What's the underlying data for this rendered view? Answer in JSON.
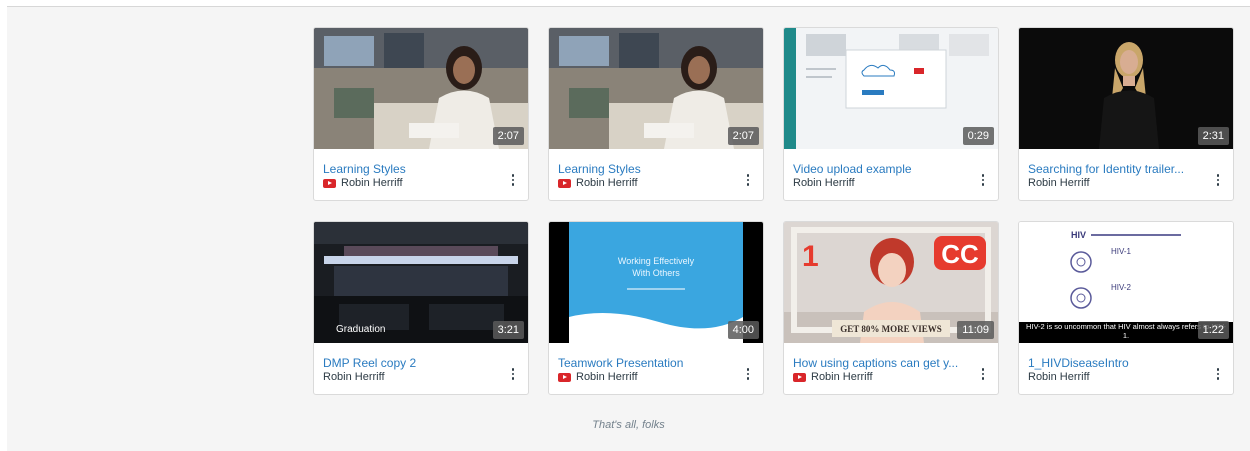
{
  "videos": [
    {
      "title": "Learning Styles",
      "author": "Robin Herriff",
      "duration": "2:07",
      "youtube": true,
      "thumb_icon": "classroom-thumbnail"
    },
    {
      "title": "Learning Styles",
      "author": "Robin Herriff",
      "duration": "2:07",
      "youtube": true,
      "thumb_icon": "classroom-thumbnail"
    },
    {
      "title": "Video upload example",
      "author": "Robin Herriff",
      "duration": "0:29",
      "youtube": false,
      "thumb_icon": "upload-screen-thumbnail"
    },
    {
      "title": "Searching for Identity trailer...",
      "author": "Robin Herriff",
      "duration": "2:31",
      "youtube": false,
      "thumb_icon": "portrait-thumbnail"
    },
    {
      "title": "DMP Reel copy 2",
      "author": "Robin Herriff",
      "duration": "3:21",
      "youtube": false,
      "thumb_icon": "graduation-thumbnail",
      "overlay_text": "Graduation"
    },
    {
      "title": "Teamwork Presentation",
      "author": "Robin Herriff",
      "duration": "4:00",
      "youtube": true,
      "thumb_icon": "slide-thumbnail",
      "overlay_text": "Working Effectively With Others"
    },
    {
      "title": "How using captions can get y...",
      "author": "Robin Herriff",
      "duration": "11:09",
      "youtube": true,
      "thumb_icon": "captions-thumbnail",
      "overlay_text": "GET 80% MORE VIEWS",
      "badge_cc": "CC",
      "badge_num": "1"
    },
    {
      "title": "1_HIVDiseaseIntro",
      "author": "Robin Herriff",
      "duration": "1:22",
      "youtube": false,
      "thumb_icon": "whiteboard-thumbnail",
      "overlay_text": "HIV-2 is so uncommon that HIV almost always refers to HIV-1.",
      "board_title": "HIV",
      "board_1": "HIV-1",
      "board_2": "HIV-2"
    }
  ],
  "footer": "That's all, folks",
  "colors": {
    "link": "#2a7bc0",
    "youtube": "#d9262a",
    "background": "#f5f5f5"
  }
}
